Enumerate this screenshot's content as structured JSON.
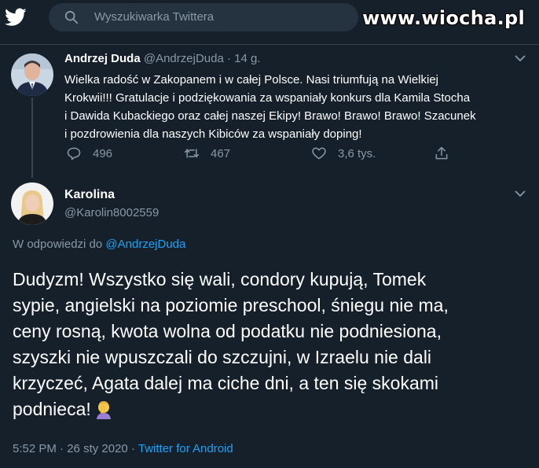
{
  "topbar": {
    "search_placeholder": "Wyszukiwarka Twittera",
    "watermark": "www.wiocha.pl"
  },
  "tweet1": {
    "name": "Andrzej Duda",
    "handle": "@AndrzejDuda",
    "separator": "·",
    "time": "14 g.",
    "lines": [
      "Wielka radość w Zakopanem i w całej Polsce. Nasi triumfują na Wielkiej",
      "Krokwii!!! Gratulacje i podziękowania za wspaniały konkurs dla Kamila Stocha",
      "i Dawida Kubackiego oraz całej naszej Ekipy! Brawo! Brawo! Brawo! Szacunek",
      "i pozdrowienia dla naszych Kibiców za wspaniały doping!"
    ],
    "replies": "496",
    "retweets": "467",
    "likes": "3,6 tys."
  },
  "tweet2": {
    "name": "Karolina",
    "handle": "@Karolin8002559",
    "reply_prefix": "W odpowiedzi do",
    "reply_handle": "@AndrzejDuda",
    "lines": [
      "Dudyzm! Wszystko się wali, condory kupują, Tomek",
      "sypie, angielski na poziomie preschool, śniegu nie ma,",
      "ceny rosną, kwota wolna od podatku nie podniesiona,",
      "szyszki nie wpuszczali do szczujni, w Izraelu nie dali",
      "krzyczeć, Agata dalej ma ciche dni, a ten się skokami",
      "podnieca!"
    ],
    "time": "5:52 PM",
    "separator": "·",
    "date": "26 sty 2020",
    "source": "Twitter for Android"
  },
  "colors": {
    "background": "#15202b",
    "secondary_text": "#8899a6",
    "link": "#1da1f2",
    "divider": "#38444d"
  },
  "icons": [
    "twitter-bird-icon",
    "search-icon",
    "chevron-down-icon",
    "reply-icon",
    "retweet-icon",
    "like-icon",
    "share-icon",
    "facepalm-emoji"
  ]
}
